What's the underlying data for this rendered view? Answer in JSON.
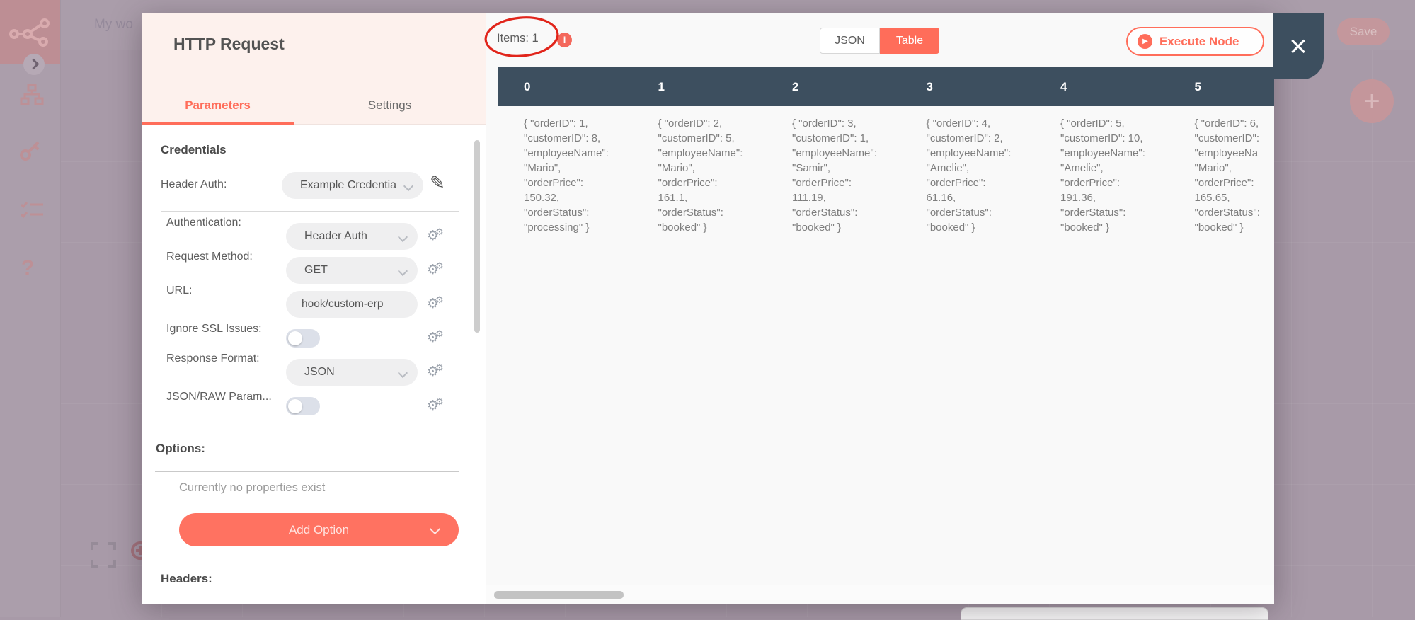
{
  "app": {
    "workflow_title": "My wo",
    "save_label": "Save",
    "plus_label": "+",
    "sidebar_icons": [
      "n8n-logo",
      "sitemap",
      "key",
      "checklist",
      "question"
    ],
    "question_glyph": "?"
  },
  "modal": {
    "title": "HTTP Request",
    "tabs": {
      "parameters": "Parameters",
      "settings": "Settings",
      "active": "Parameters"
    },
    "credentials": {
      "heading": "Credentials",
      "label": "Header Auth:",
      "value": "Example Credentia"
    },
    "fields": [
      {
        "label": "Authentication:",
        "value": "Header Auth",
        "type": "select"
      },
      {
        "label": "Request Method:",
        "value": "GET",
        "type": "select"
      },
      {
        "label": "URL:",
        "value": "hook/custom-erp",
        "type": "text"
      },
      {
        "label": "Ignore SSL Issues:",
        "value": "off",
        "type": "toggle"
      },
      {
        "label": "Response Format:",
        "value": "JSON",
        "type": "select"
      },
      {
        "label": "JSON/RAW Param...",
        "value": "off",
        "type": "toggle"
      }
    ],
    "options": {
      "heading": "Options:",
      "empty_text": "Currently no properties exist",
      "add_button": "Add Option"
    },
    "headers_heading": "Headers:"
  },
  "results": {
    "items_label": "Items: 1",
    "info_glyph": "i",
    "view_toggle": {
      "json": "JSON",
      "table": "Table",
      "selected": "Table"
    },
    "execute_button": "Execute Node",
    "close_glyph": "×",
    "table": {
      "columns": [
        "0",
        "1",
        "2",
        "3",
        "4",
        "5"
      ],
      "cells": [
        [
          "{ \"orderID\": 1,",
          "\"customerID\": 8,",
          "\"employeeName\":",
          "\"Mario\",",
          "\"orderPrice\":",
          "150.32,",
          "\"orderStatus\":",
          "\"processing\" }"
        ],
        [
          "{ \"orderID\": 2,",
          "\"customerID\": 5,",
          "\"employeeName\":",
          "\"Mario\",",
          "\"orderPrice\":",
          "161.1,",
          "\"orderStatus\":",
          "\"booked\" }"
        ],
        [
          "{ \"orderID\": 3,",
          "\"customerID\": 1,",
          "\"employeeName\":",
          "\"Samir\",",
          "\"orderPrice\":",
          "111.19,",
          "\"orderStatus\":",
          "\"booked\" }"
        ],
        [
          "{ \"orderID\": 4,",
          "\"customerID\": 2,",
          "\"employeeName\":",
          "\"Amelie\",",
          "\"orderPrice\":",
          "61.16,",
          "\"orderStatus\":",
          "\"booked\" }"
        ],
        [
          "{ \"orderID\": 5,",
          "\"customerID\": 10,",
          "\"employeeName\":",
          "\"Amelie\",",
          "\"orderPrice\":",
          "191.36,",
          "\"orderStatus\":",
          "\"booked\" }"
        ],
        [
          "{ \"orderID\": 6,",
          "\"customerID\":",
          "\"employeeNa",
          "\"Mario\",",
          "\"orderPrice\":",
          "165.65,",
          "\"orderStatus\":",
          "\"booked\" }"
        ]
      ]
    }
  },
  "colors": {
    "accent": "#ff6d5a",
    "table_header": "#3d4f5f",
    "annotation_red": "#e1251b",
    "overlay_tint": "#a89aa8",
    "panel_pink": "#fdf1ed"
  }
}
